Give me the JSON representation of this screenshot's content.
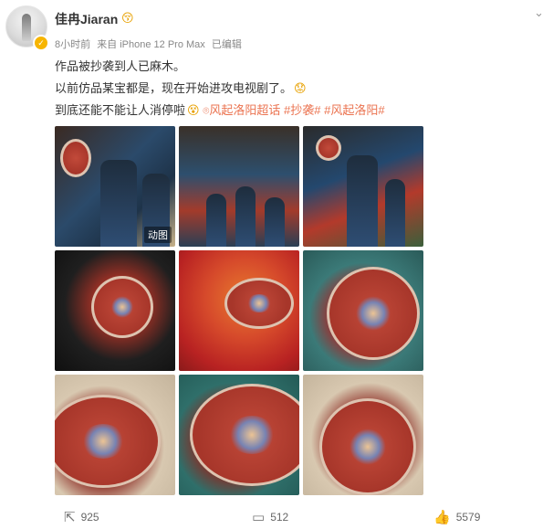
{
  "user": {
    "name": "佳冉Jiaran",
    "name_emoji": "😚",
    "verified_icon": "v-badge-icon"
  },
  "meta": {
    "time": "8小时前",
    "source": "来自 iPhone 12 Pro Max",
    "edited": "已编辑"
  },
  "menu_icon": "chevron-down-icon",
  "post": {
    "line1": "作品被抄袭到人已麻木。",
    "line2": "以前仿品某宝都是，现在开始进攻电视剧了。",
    "line2_emoji": "😟",
    "line3_prefix": "到底还能不能让人消停啦",
    "line3_emoji": "😵",
    "topic_icon": "topic-link-icon",
    "tag1": "风起洛阳超话",
    "tag2": "#抄袭#",
    "tag3": "#风起洛阳#"
  },
  "images": {
    "gif_label": "动图",
    "count": 9
  },
  "actions": {
    "repost_icon": "share-icon",
    "repost_count": "925",
    "comment_icon": "comment-icon",
    "comment_count": "512",
    "like_icon": "thumbs-up-icon",
    "like_count": "5579"
  },
  "colors": {
    "link": "#eb7350",
    "meta_text": "#888888",
    "body_text": "#333333",
    "vip_badge": "#f7b500"
  }
}
